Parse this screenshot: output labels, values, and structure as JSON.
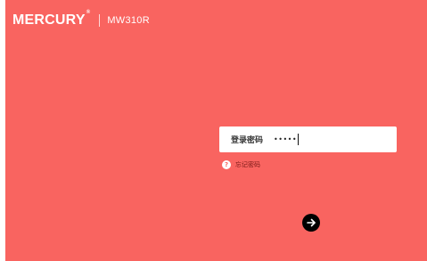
{
  "header": {
    "brand": "MERCURY",
    "registered_mark": "®",
    "model": "MW310R"
  },
  "login": {
    "label": "登录密码",
    "password_masked": "•••••",
    "forgot_text": "忘记密码",
    "help_glyph": "?"
  },
  "icons": {
    "help": "question-circle-icon",
    "submit": "arrow-right-icon"
  },
  "colors": {
    "background": "#f96460",
    "box": "#ffffff",
    "submit": "#000000"
  }
}
